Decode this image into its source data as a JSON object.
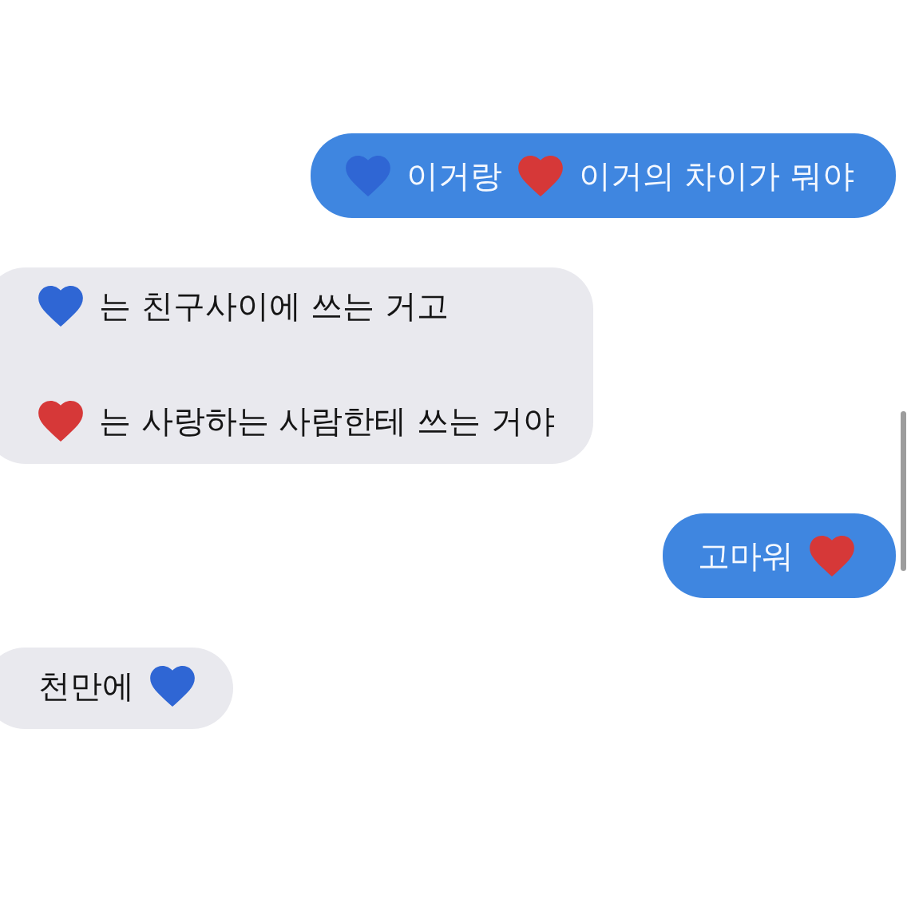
{
  "messages": [
    {
      "kind": "sent",
      "lines": [
        [
          {
            "kind": "heart",
            "color": "#2f66d4"
          },
          {
            "kind": "text",
            "text": "이거랑"
          },
          {
            "kind": "heart",
            "color": "#d63838"
          },
          {
            "kind": "text",
            "text": "이거의 차이가 뭐야"
          }
        ]
      ]
    },
    {
      "kind": "received",
      "lines": [
        [
          {
            "kind": "heart",
            "color": "#2f66d4"
          },
          {
            "kind": "text",
            "text": "는 친구사이에 쓰는 거고"
          }
        ],
        [
          {
            "kind": "heart",
            "color": "#d63838"
          },
          {
            "kind": "text",
            "text": "는 사랑하는 사람한테 쓰는 거야"
          }
        ]
      ]
    },
    {
      "kind": "sent",
      "lines": [
        [
          {
            "kind": "text",
            "text": "고마워"
          },
          {
            "kind": "heart",
            "color": "#d63838"
          }
        ]
      ]
    },
    {
      "kind": "received",
      "lines": [
        [
          {
            "kind": "text",
            "text": "천만에"
          },
          {
            "kind": "heart",
            "color": "#2f66d4"
          }
        ]
      ]
    }
  ]
}
